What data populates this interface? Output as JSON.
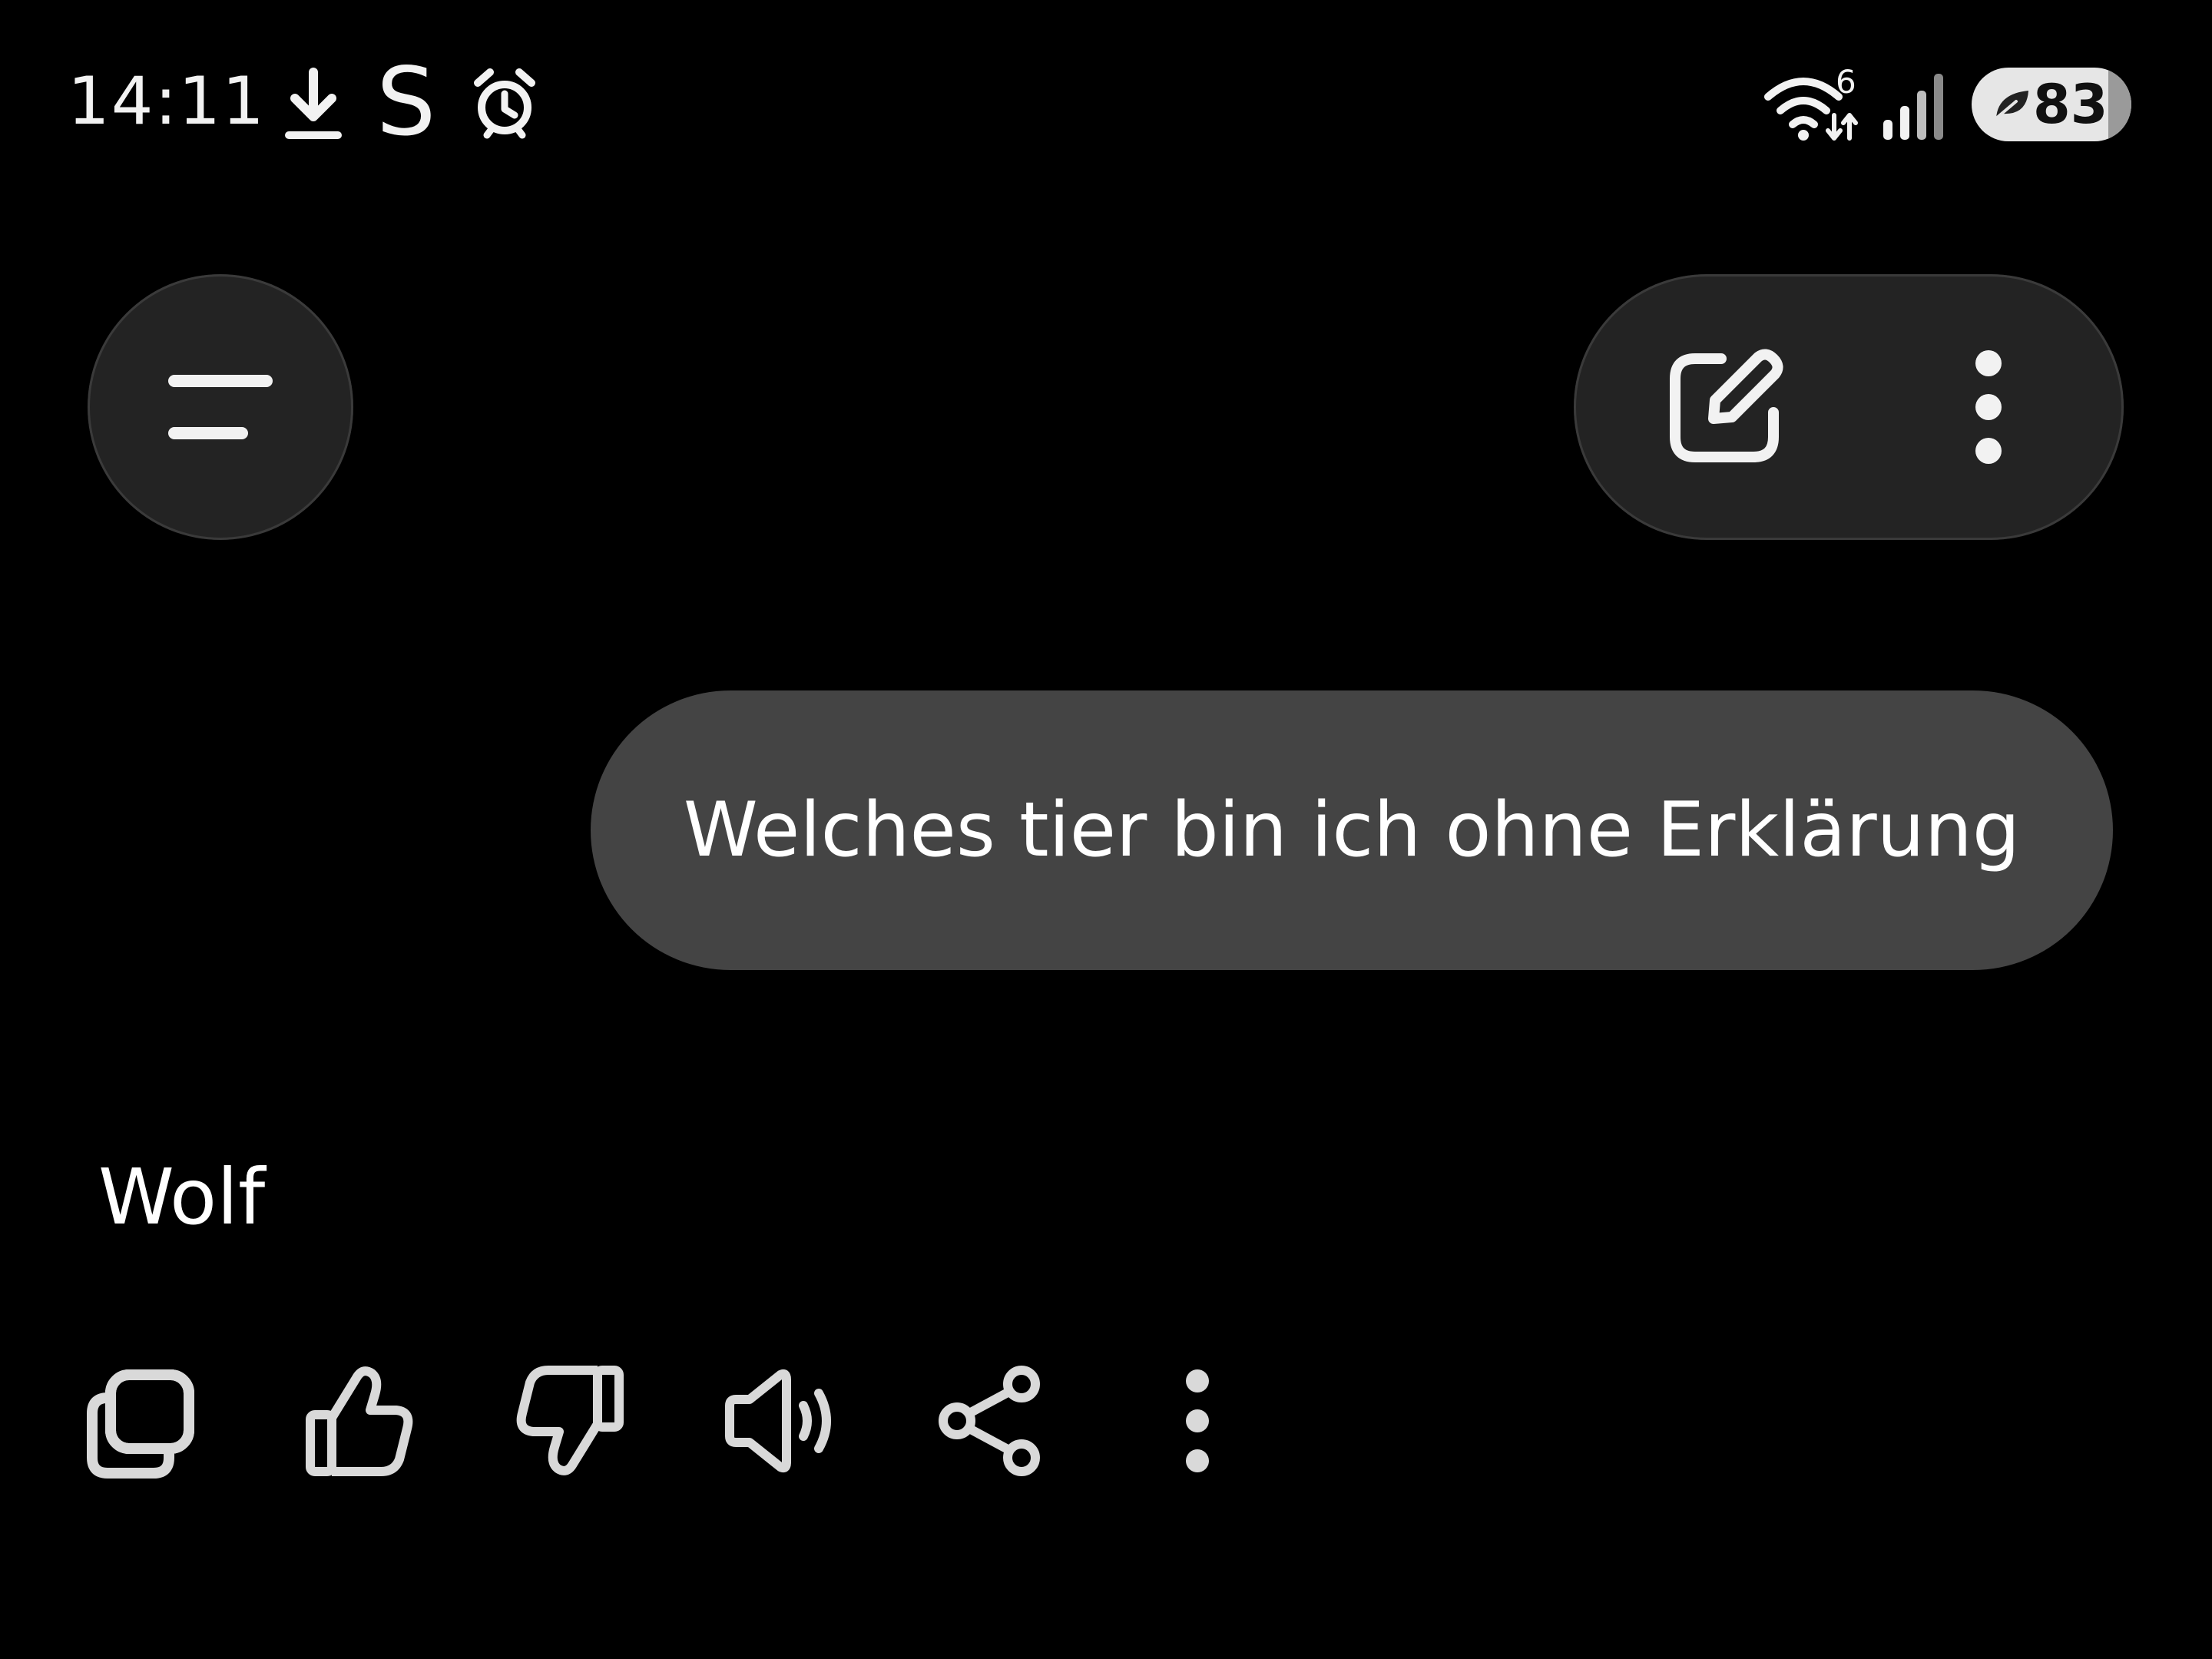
{
  "status_bar": {
    "time": "14:11",
    "notification_icons": [
      "download-icon",
      "s-app-icon",
      "alarm-icon"
    ],
    "s_glyph": "S",
    "wifi_badge": "6",
    "battery_level": 83,
    "battery_text": "83"
  },
  "top_bar": {
    "menu_icon": "menu-icon",
    "new_chat_icon": "edit-icon",
    "more_icon": "more-vertical-icon"
  },
  "conversation": {
    "user_message": "Welches tier bin ich ohne Erklärung",
    "assistant_response": "Wolf"
  },
  "response_actions": [
    {
      "icon": "copy-icon"
    },
    {
      "icon": "thumbs-up-icon"
    },
    {
      "icon": "thumbs-down-icon"
    },
    {
      "icon": "speaker-icon"
    },
    {
      "icon": "share-icon"
    },
    {
      "icon": "more-vertical-icon"
    }
  ],
  "colors": {
    "background": "#000000",
    "surface": "#232323",
    "bubble": "#444444",
    "foreground": "#ffffff",
    "icon": "#d9d9d9"
  }
}
